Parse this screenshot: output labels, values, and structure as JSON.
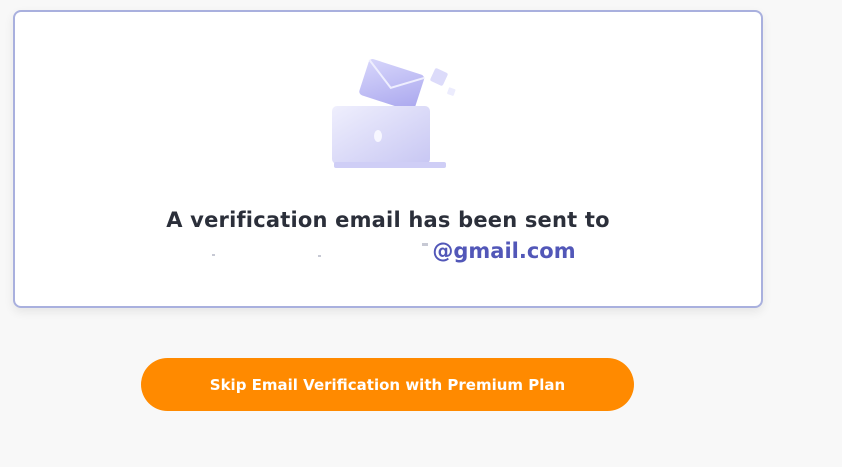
{
  "verification": {
    "message": "A verification email has been sent to",
    "email_domain": "@gmail.com",
    "illustration_icon": "laptop-with-envelope-icon"
  },
  "actions": {
    "skip_button_label": "Skip Email Verification with Premium Plan"
  },
  "colors": {
    "accent": "#ff8a00",
    "email_text": "#5257b8",
    "card_border": "#a9b0de",
    "illustration": "#c9c8f5"
  }
}
